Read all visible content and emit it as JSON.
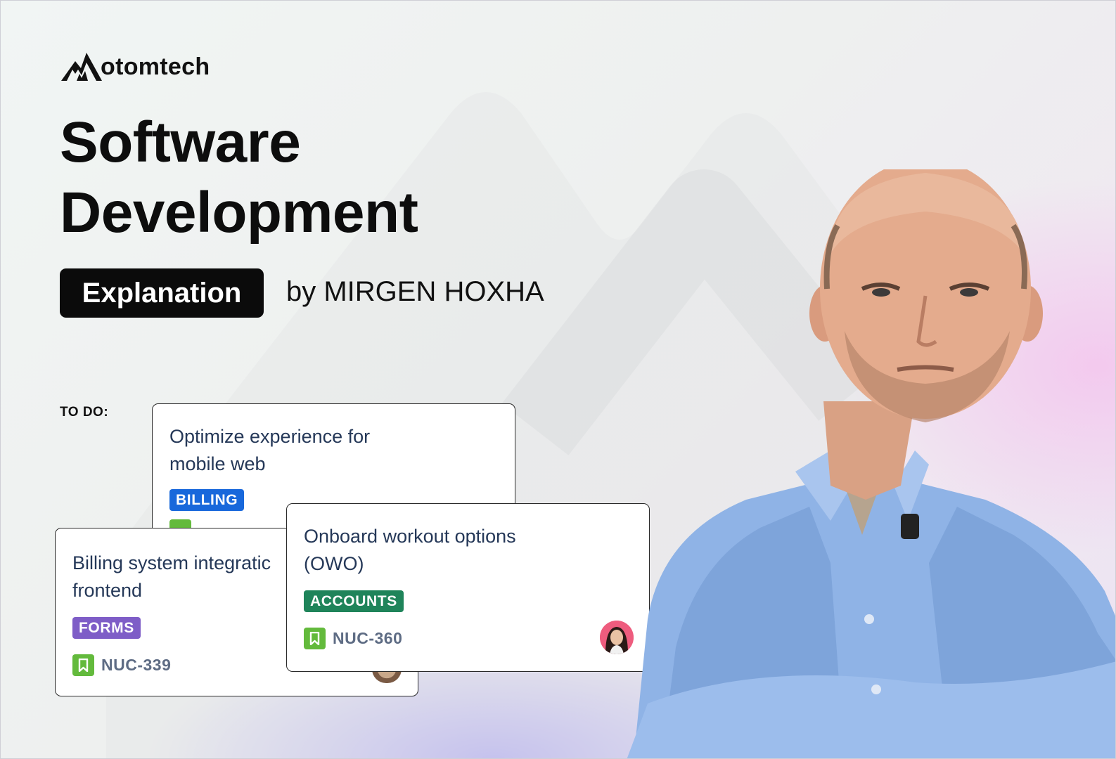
{
  "brand": {
    "name": "otomtech",
    "logo_icon": "mountain-m-logo",
    "logo_letter": "M"
  },
  "headline": {
    "line1": "Software",
    "line2": "Development"
  },
  "tag": "Explanation",
  "byline": "by MIRGEN HOXHA",
  "board": {
    "column_label": "TO DO:",
    "cards": [
      {
        "title": "Optimize experience for mobile web",
        "title_line1": "Optimize experience for",
        "title_line2": "mobile web",
        "label": "BILLING",
        "label_color": "#1868db",
        "icon": "story-bookmark-icon"
      },
      {
        "title": "Billing system integratic frontend",
        "title_line1": "Billing system integratic",
        "title_line2": "frontend",
        "label": "FORMS",
        "label_color": "#7e5dc7",
        "key": "NUC-339",
        "icon": "story-bookmark-icon"
      },
      {
        "title": "Onboard workout options (OWO)",
        "title_line1": "Onboard workout options",
        "title_line2": "(OWO)",
        "label": "ACCOUNTS",
        "label_color": "#1f845a",
        "key": "NUC-360",
        "icon": "story-bookmark-icon",
        "assignee_icon": "avatar-icon"
      }
    ]
  },
  "colors": {
    "story_green": "#63ba3c",
    "text_dark": "#253858",
    "key_grey": "#5e6c84"
  }
}
